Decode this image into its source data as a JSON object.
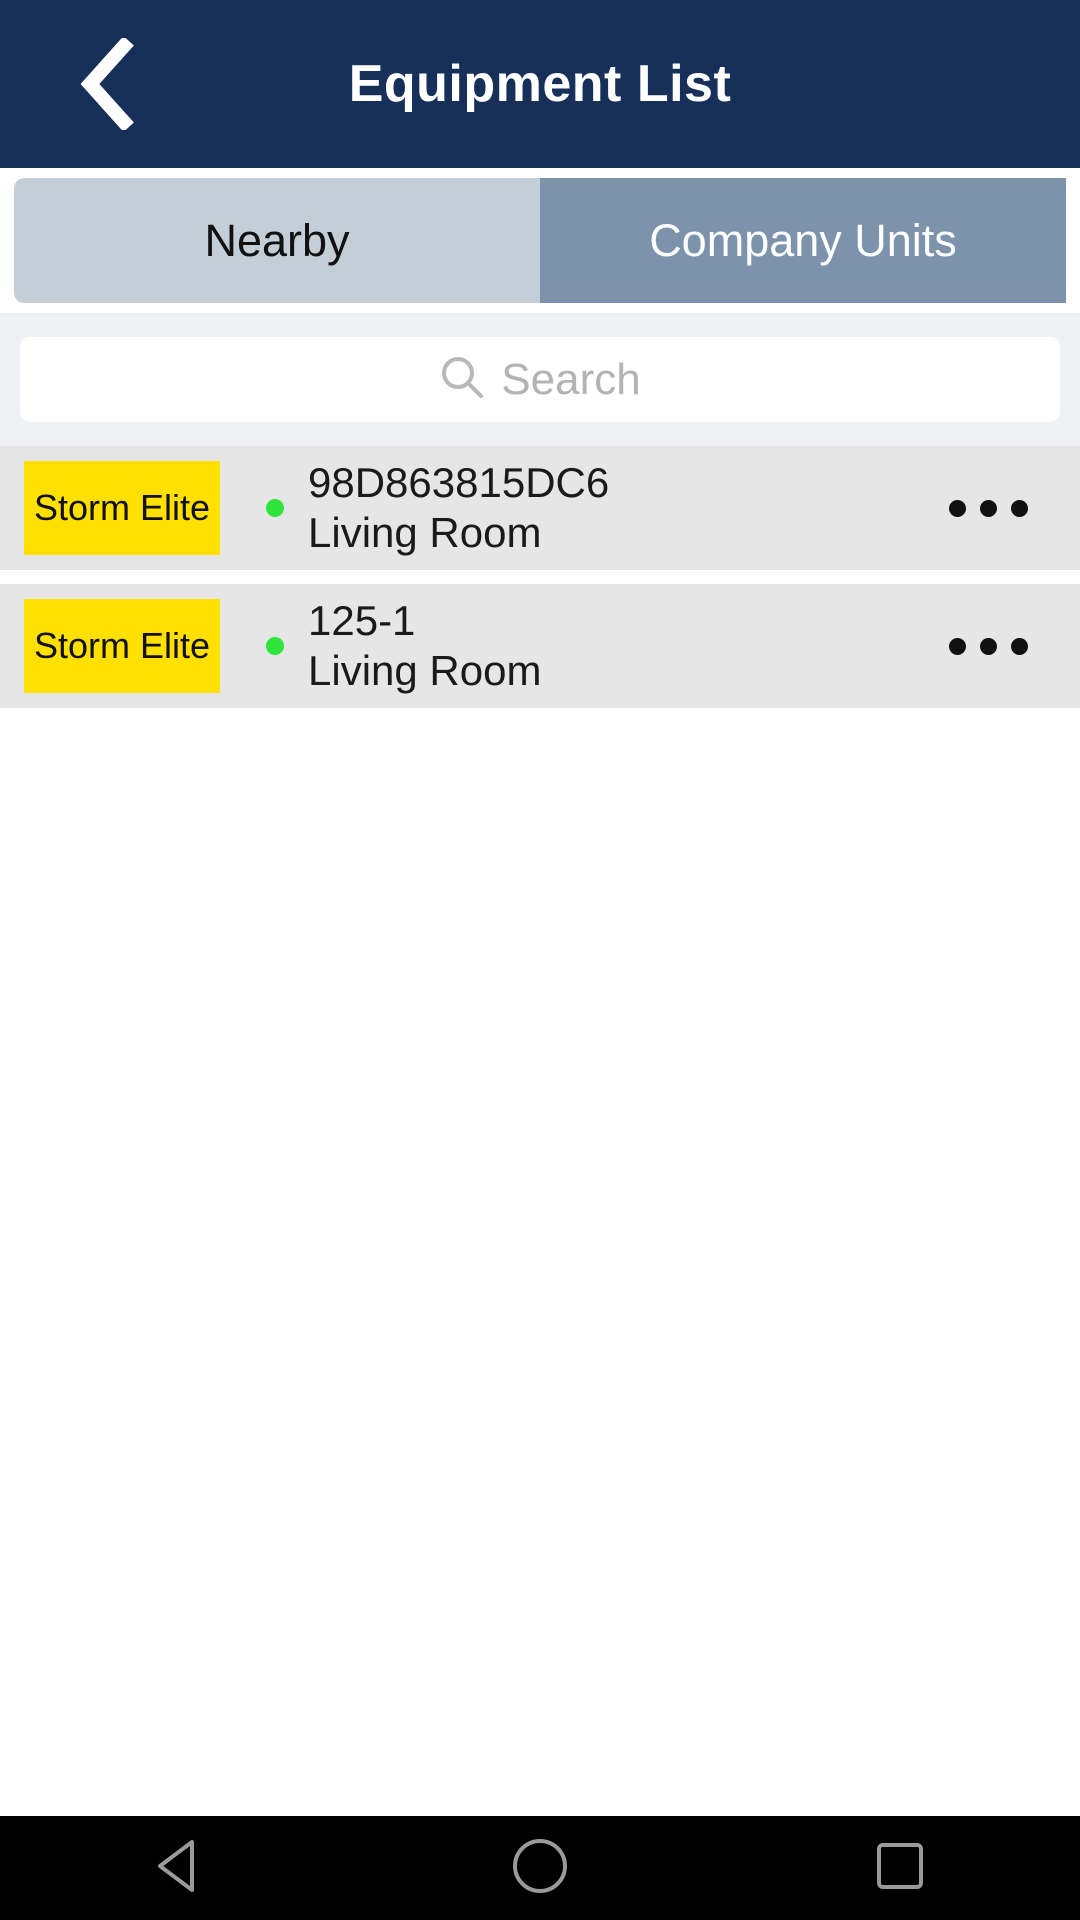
{
  "appbar": {
    "title": "Equipment List",
    "back_icon": "chevron-left-icon",
    "background_color": "#173059",
    "title_color": "#ffffff"
  },
  "tabs": {
    "selected": "Company Units",
    "items": [
      {
        "label": "Nearby",
        "selected": false,
        "background_color": "#c3ced6",
        "text_color": "#111111"
      },
      {
        "label": "Company Units",
        "selected": true,
        "background_color": "#7d93ab",
        "text_color": "#ffffff"
      }
    ]
  },
  "search": {
    "placeholder": "Search",
    "value": "",
    "icon": "search-icon",
    "background_color": "#eef0f3",
    "field_color": "#ffffff"
  },
  "list": {
    "row_background_color": "#e6e6e6",
    "badge_color": "#ffe000",
    "status_online_color": "#2fe43a",
    "items": [
      {
        "badge": "Storm Elite",
        "device_id": "98D863815DC6",
        "location": "Living Room",
        "status": "online",
        "overflow_icon": "more-horizontal-icon"
      },
      {
        "badge": "Storm Elite",
        "device_id": "125-1",
        "location": "Living Room",
        "status": "online",
        "overflow_icon": "more-horizontal-icon"
      }
    ]
  },
  "navbar": {
    "background_color": "#000000",
    "icon_color": "#9a9a9a",
    "buttons": [
      {
        "icon": "triangle-back-icon",
        "name": "back"
      },
      {
        "icon": "circle-home-icon",
        "name": "home"
      },
      {
        "icon": "square-recents-icon",
        "name": "recents"
      }
    ]
  }
}
